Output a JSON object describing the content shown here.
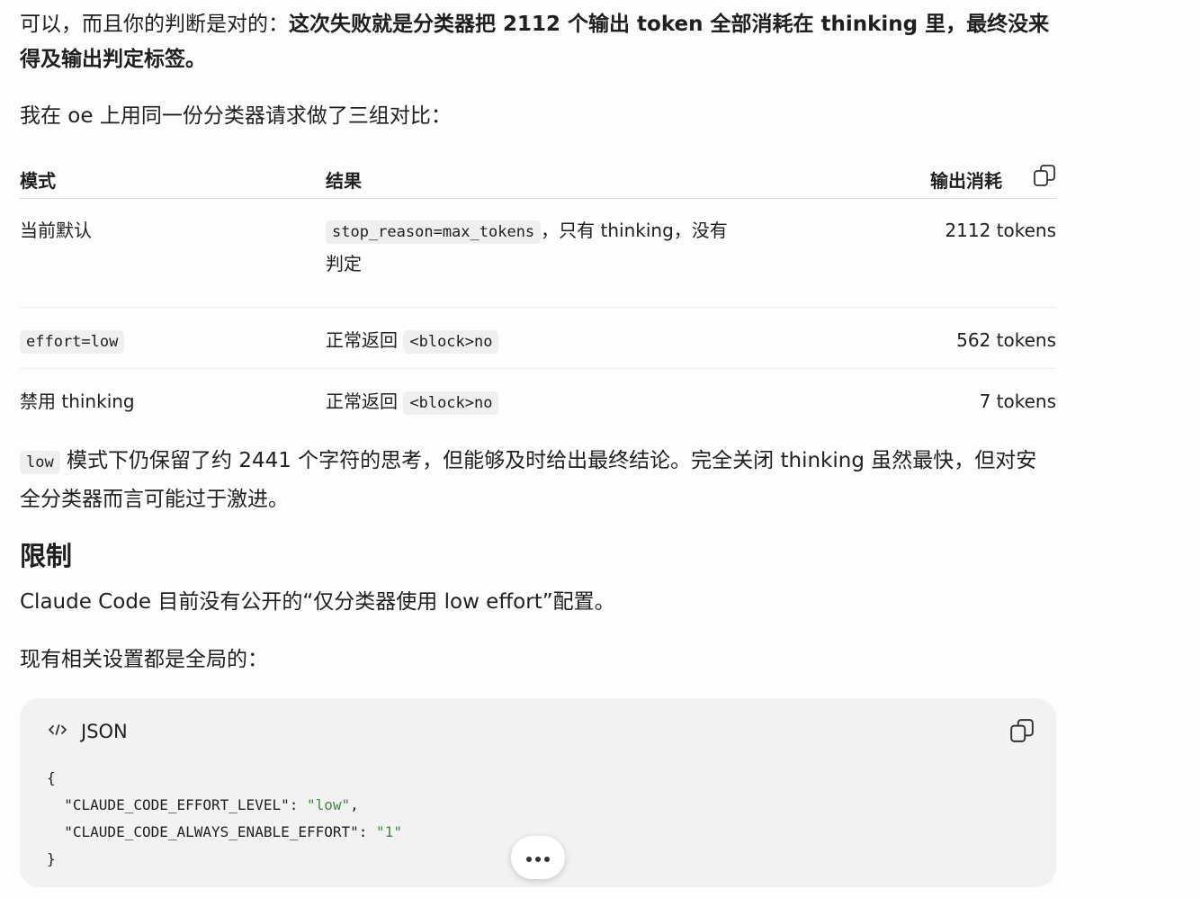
{
  "intro": {
    "text_normal": "可以，而且你的判断是对的：",
    "text_bold": "这次失败就是分类器把 2112 个输出 token 全部消耗在 thinking 里，最终没来得及输出判定标签。"
  },
  "lead": "我在 oe 上用同一份分类器请求做了三组对比：",
  "table": {
    "headers": [
      "模式",
      "结果",
      "输出消耗"
    ],
    "copy_icon": "copy-icon",
    "rows": [
      {
        "mode_text": "当前默认",
        "result_code": "stop_reason=max_tokens",
        "result_text": "，只有 thinking，没有判定",
        "tokens": "2112 tokens"
      },
      {
        "mode_code": "effort=low",
        "result_text": "正常返回",
        "result_code": "<block>no",
        "tokens": "562 tokens"
      },
      {
        "mode_text": "禁用 thinking",
        "result_text": "正常返回",
        "result_code": "<block>no",
        "tokens": "7 tokens"
      }
    ]
  },
  "note": {
    "code": "low",
    "text": " 模式下仍保留了约 2441 个字符的思考，但能够及时给出最终结论。完全关闭 thinking 虽然最快，但对安全分类器而言可能过于激进。"
  },
  "limits_heading": "限制",
  "limits_text": "Claude Code 目前没有公开的“仅分类器使用 low effort”配置。",
  "settings_lead": "现有相关设置都是全局的：",
  "codeblock": {
    "icon": "code-icon",
    "language": "JSON",
    "copy_icon": "copy-icon",
    "open": "{",
    "key1": "\"CLAUDE_CODE_EFFORT_LEVEL\"",
    "val1": "\"low\"",
    "key2": "\"CLAUDE_CODE_ALWAYS_ENABLE_EFFORT\"",
    "val2": "\"1\"",
    "close": "}"
  },
  "more_button": {
    "icon": "more-horizontal-icon"
  }
}
